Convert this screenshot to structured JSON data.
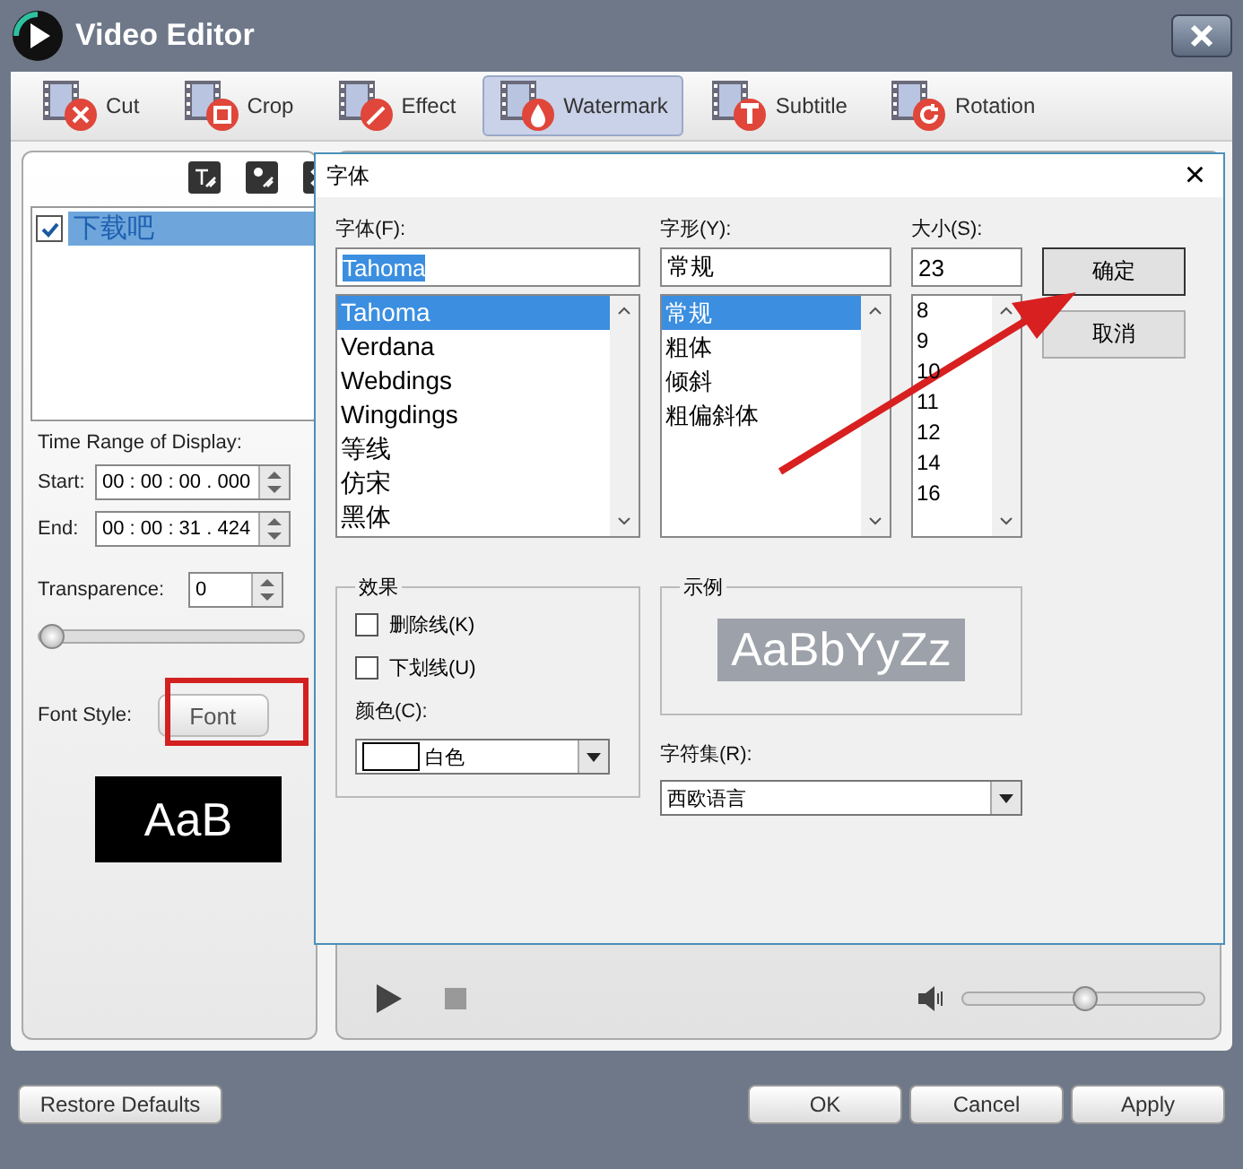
{
  "window": {
    "title": "Video Editor"
  },
  "toolbar": [
    {
      "label": "Cut",
      "kind": "cut",
      "selected": false
    },
    {
      "label": "Crop",
      "kind": "crop",
      "selected": false
    },
    {
      "label": "Effect",
      "kind": "effect",
      "selected": false
    },
    {
      "label": "Watermark",
      "kind": "watermark",
      "selected": true
    },
    {
      "label": "Subtitle",
      "kind": "subtitle",
      "selected": false
    },
    {
      "label": "Rotation",
      "kind": "rotation",
      "selected": false
    }
  ],
  "watermark_panel": {
    "items": [
      {
        "label": "下载吧",
        "checked": true,
        "selected": true
      }
    ],
    "time_range_label": "Time Range of Display:",
    "start": {
      "label": "Start:",
      "value": "00 : 00 : 00 . 000"
    },
    "end": {
      "label": "End:",
      "value": "00 : 00 : 31 . 424"
    },
    "transparence": {
      "label": "Transparence:",
      "value": "0",
      "level": 0.0
    },
    "font_style_label": "Font Style:",
    "font_button": "Font",
    "preview": "AaB"
  },
  "player": {
    "volume": {
      "level": 0.5
    }
  },
  "buttons": {
    "restore": "Restore Defaults",
    "ok": "OK",
    "cancel": "Cancel",
    "apply": "Apply"
  },
  "font_dialog": {
    "title": "字体",
    "close": "×",
    "font": {
      "label": "字体(F):",
      "value": "Tahoma",
      "options": [
        {
          "label": "Tahoma",
          "selected": true
        },
        {
          "label": "Verdana",
          "selected": false
        },
        {
          "label": "Webdings",
          "selected": false
        },
        {
          "label": "Wingdings",
          "selected": false
        },
        {
          "label": "等线",
          "selected": false
        },
        {
          "label": "仿宋",
          "selected": false
        },
        {
          "label": "黑体",
          "selected": false
        }
      ]
    },
    "style": {
      "label": "字形(Y):",
      "value": "常规",
      "options": [
        {
          "label": "常规",
          "selected": true
        },
        {
          "label": "粗体",
          "selected": false
        },
        {
          "label": "倾斜",
          "selected": false
        },
        {
          "label": "粗偏斜体",
          "selected": false
        }
      ]
    },
    "size": {
      "label": "大小(S):",
      "value": "23",
      "options": [
        {
          "label": "8",
          "selected": false
        },
        {
          "label": "9",
          "selected": false
        },
        {
          "label": "10",
          "selected": false
        },
        {
          "label": "11",
          "selected": false
        },
        {
          "label": "12",
          "selected": false
        },
        {
          "label": "14",
          "selected": false
        },
        {
          "label": "16",
          "selected": false
        }
      ]
    },
    "ok": "确定",
    "cancel": "取消",
    "effects": {
      "title": "效果",
      "strikeout": {
        "label": "删除线(K)",
        "checked": false
      },
      "underline": {
        "label": "下划线(U)",
        "checked": false
      },
      "color_label": "颜色(C):",
      "color": {
        "label": "白色",
        "color": "#ffffff"
      }
    },
    "sample": {
      "title": "示例",
      "text": "AaBbYyZz"
    },
    "charset": {
      "label": "字符集(R):",
      "value": "西欧语言"
    }
  }
}
